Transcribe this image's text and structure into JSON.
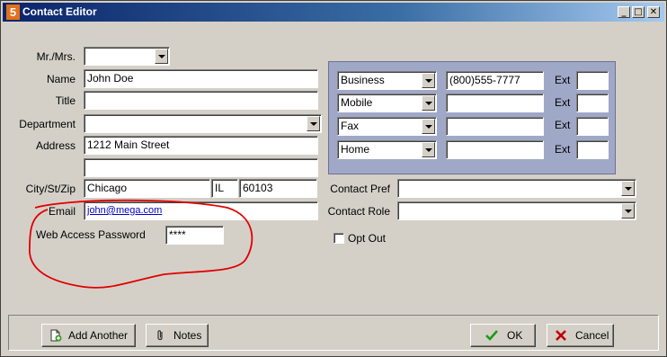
{
  "window": {
    "title": "Contact Editor",
    "app_icon": "5"
  },
  "labels": {
    "salutation": "Mr./Mrs.",
    "name": "Name",
    "title": "Title",
    "department": "Department",
    "address": "Address",
    "city_st_zip": "City/St/Zip",
    "email": "Email",
    "web_password": "Web Access Password",
    "contact_pref": "Contact Pref",
    "contact_role": "Contact Role",
    "opt_out": "Opt Out"
  },
  "fields": {
    "salutation": "",
    "name": "John Doe",
    "title": "",
    "department": "",
    "address1": "1212 Main Street",
    "address2": "",
    "city": "Chicago",
    "state": "IL",
    "zip": "60103",
    "email": "john@mega.com",
    "password_mask": "****",
    "contact_pref": "",
    "contact_role": ""
  },
  "phones": [
    {
      "type": "Business",
      "number": "(800)555-7777",
      "ext_label": "Ext",
      "ext": ""
    },
    {
      "type": "Mobile",
      "number": "",
      "ext_label": "Ext",
      "ext": ""
    },
    {
      "type": "Fax",
      "number": "",
      "ext_label": "Ext",
      "ext": ""
    },
    {
      "type": "Home",
      "number": "",
      "ext_label": "Ext",
      "ext": ""
    }
  ],
  "buttons": {
    "add_another": "Add Another",
    "notes": "Notes",
    "ok": "OK",
    "cancel": "Cancel"
  },
  "colors": {
    "titlebar": "#0a246a",
    "phone_panel": "#a0a8c8",
    "annotation": "#e00000"
  }
}
